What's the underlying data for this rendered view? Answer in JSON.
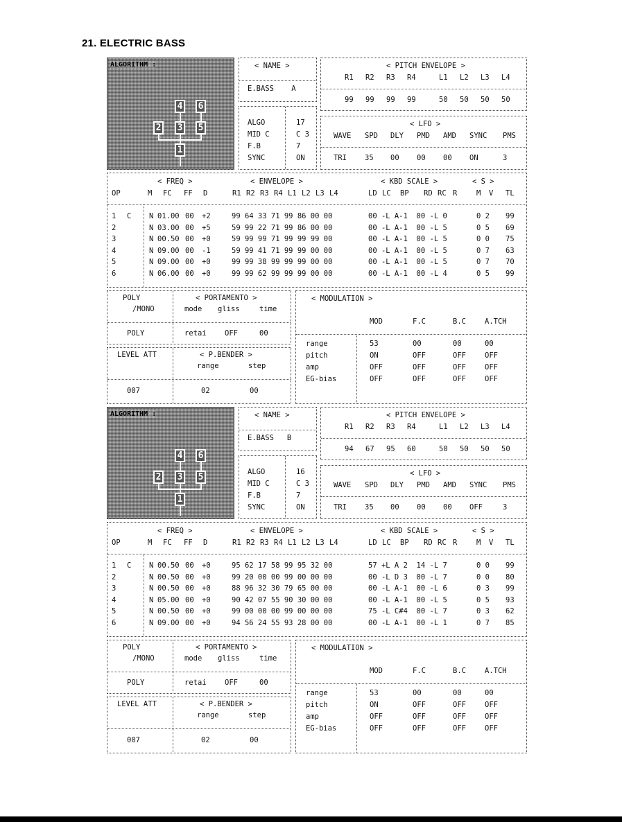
{
  "page_title": "21. ELECTRIC BASS",
  "patches": [
    {
      "algorithm_label": "ALGORITHM :",
      "name_header": "< NAME >",
      "name_value": "E.BASS    A",
      "algo_labels": [
        "ALGO",
        "MID C",
        "F.B",
        "SYNC"
      ],
      "algo_values": [
        "17",
        "C 3",
        "7",
        "ON"
      ],
      "pitch_env": {
        "header": "< PITCH ENVELOPE >",
        "labels": [
          "R1",
          "R2",
          "R3",
          "R4",
          "L1",
          "L2",
          "L3",
          "L4"
        ],
        "values": [
          "99",
          "99",
          "99",
          "99",
          "50",
          "50",
          "50",
          "50"
        ]
      },
      "lfo": {
        "header": "< LFO >",
        "labels": [
          "WAVE",
          "SPD",
          "DLY",
          "PMD",
          "AMD",
          "SYNC",
          "PMS"
        ],
        "values": [
          "TRI",
          "35",
          "00",
          "00",
          "00",
          "ON",
          "3"
        ]
      },
      "ops": {
        "group_headers": [
          "< FREQ >",
          "< ENVELOPE >",
          "< KBD SCALE >",
          "< S >"
        ],
        "columns": [
          "OP",
          "M",
          "FC",
          "FF",
          "D",
          "R1",
          "R2",
          "R3",
          "R4",
          "L1",
          "L2",
          "L3",
          "L4",
          "LD",
          "LC",
          "BP",
          "RD",
          "RC",
          "R",
          "M",
          "V",
          "TL"
        ],
        "rows": [
          {
            "op": "1",
            "c": "C",
            "m": "N",
            "fc": "01.00",
            "ff": "00",
            "d": "+2",
            "env": "99 64 33 71 99 86 00 00",
            "kbd": "00 -L A-1  00 -L 0",
            "s": "0 2",
            "tl": "99"
          },
          {
            "op": "2",
            "c": "",
            "m": "N",
            "fc": "03.00",
            "ff": "00",
            "d": "+5",
            "env": "59 99 22 71 99 86 00 00",
            "kbd": "00 -L A-1  00 -L 5",
            "s": "0 5",
            "tl": "69"
          },
          {
            "op": "3",
            "c": "",
            "m": "N",
            "fc": "00.50",
            "ff": "00",
            "d": "+0",
            "env": "59 99 99 71 99 99 99 00",
            "kbd": "00 -L A-1  00 -L 5",
            "s": "0 0",
            "tl": "75"
          },
          {
            "op": "4",
            "c": "",
            "m": "N",
            "fc": "09.00",
            "ff": "00",
            "d": "-1",
            "env": "59 99 41 71 99 99 00 00",
            "kbd": "00 -L A-1  00 -L 5",
            "s": "0 7",
            "tl": "63"
          },
          {
            "op": "5",
            "c": "",
            "m": "N",
            "fc": "09.00",
            "ff": "00",
            "d": "+0",
            "env": "99 99 38 99 99 99 00 00",
            "kbd": "00 -L A-1  00 -L 5",
            "s": "0 7",
            "tl": "70"
          },
          {
            "op": "6",
            "c": "",
            "m": "N",
            "fc": "06.00",
            "ff": "00",
            "d": "+0",
            "env": "99 99 62 99 99 99 00 00",
            "kbd": "00 -L A-1  00 -L 4",
            "s": "0 5",
            "tl": "99"
          }
        ]
      },
      "poly_mono": {
        "label1": "POLY",
        "label2": "/MONO",
        "value": "POLY"
      },
      "portamento": {
        "header": "< PORTAMENTO >",
        "labels": [
          "mode",
          "gliss",
          "time"
        ],
        "values": [
          "retai",
          "OFF",
          "00"
        ]
      },
      "level_att": {
        "label": "LEVEL ATT",
        "value": "007"
      },
      "p_bender": {
        "header": "< P.BENDER >",
        "labels": [
          "range",
          "step"
        ],
        "values": [
          "02",
          "00"
        ]
      },
      "modulation": {
        "header": "< MODULATION >",
        "columns": [
          "MOD",
          "F.C",
          "B.C",
          "A.TCH"
        ],
        "rows": [
          {
            "label": "range",
            "values": [
              "53",
              "00",
              "00",
              "00"
            ]
          },
          {
            "label": "pitch",
            "values": [
              "ON",
              "OFF",
              "OFF",
              "OFF"
            ]
          },
          {
            "label": "amp",
            "values": [
              "OFF",
              "OFF",
              "OFF",
              "OFF"
            ]
          },
          {
            "label": "EG-bias",
            "values": [
              "OFF",
              "OFF",
              "OFF",
              "OFF"
            ]
          }
        ]
      }
    },
    {
      "algorithm_label": "ALGORITHM :",
      "name_header": "< NAME >",
      "name_value": "E.BASS   B",
      "algo_labels": [
        "ALGO",
        "MID C",
        "F.B",
        "SYNC"
      ],
      "algo_values": [
        "16",
        "C 3",
        "7",
        "ON"
      ],
      "pitch_env": {
        "header": "< PITCH ENVELOPE >",
        "labels": [
          "R1",
          "R2",
          "R3",
          "R4",
          "L1",
          "L2",
          "L3",
          "L4"
        ],
        "values": [
          "94",
          "67",
          "95",
          "60",
          "50",
          "50",
          "50",
          "50"
        ]
      },
      "lfo": {
        "header": "< LFO >",
        "labels": [
          "WAVE",
          "SPD",
          "DLY",
          "PMD",
          "AMD",
          "SYNC",
          "PMS"
        ],
        "values": [
          "TRI",
          "35",
          "00",
          "00",
          "00",
          "OFF",
          "3"
        ]
      },
      "ops": {
        "group_headers": [
          "< FREQ >",
          "< ENVELOPE >",
          "< KBD SCALE >",
          "< S >"
        ],
        "columns": [
          "OP",
          "M",
          "FC",
          "FF",
          "D",
          "R1",
          "R2",
          "R3",
          "R4",
          "L1",
          "L2",
          "L3",
          "L4",
          "LD",
          "LC",
          "BP",
          "RD",
          "RC",
          "R",
          "M",
          "V",
          "TL"
        ],
        "rows": [
          {
            "op": "1",
            "c": "C",
            "m": "N",
            "fc": "00.50",
            "ff": "00",
            "d": "+0",
            "env": "95 62 17 58 99 95 32 00",
            "kbd": "57 +L A 2  14 -L 7",
            "s": "0 0",
            "tl": "99"
          },
          {
            "op": "2",
            "c": "",
            "m": "N",
            "fc": "00.50",
            "ff": "00",
            "d": "+0",
            "env": "99 20 00 00 99 00 00 00",
            "kbd": "00 -L D 3  00 -L 7",
            "s": "0 0",
            "tl": "80"
          },
          {
            "op": "3",
            "c": "",
            "m": "N",
            "fc": "00.50",
            "ff": "00",
            "d": "+0",
            "env": "88 96 32 30 79 65 00 00",
            "kbd": "00 -L A-1  00 -L 6",
            "s": "0 3",
            "tl": "99"
          },
          {
            "op": "4",
            "c": "",
            "m": "N",
            "fc": "05.00",
            "ff": "00",
            "d": "+0",
            "env": "90 42 07 55 90 30 00 00",
            "kbd": "00 -L A-1  00 -L 5",
            "s": "0 5",
            "tl": "93"
          },
          {
            "op": "5",
            "c": "",
            "m": "N",
            "fc": "00.50",
            "ff": "00",
            "d": "+0",
            "env": "99 00 00 00 99 00 00 00",
            "kbd": "75 -L C#4  00 -L 7",
            "s": "0 3",
            "tl": "62"
          },
          {
            "op": "6",
            "c": "",
            "m": "N",
            "fc": "09.00",
            "ff": "00",
            "d": "+0",
            "env": "94 56 24 55 93 28 00 00",
            "kbd": "00 -L A-1  00 -L 1",
            "s": "0 7",
            "tl": "85"
          }
        ]
      },
      "poly_mono": {
        "label1": "POLY",
        "label2": "/MONO",
        "value": "POLY"
      },
      "portamento": {
        "header": "< PORTAMENTO >",
        "labels": [
          "mode",
          "gliss",
          "time"
        ],
        "values": [
          "retai",
          "OFF",
          "00"
        ]
      },
      "level_att": {
        "label": "LEVEL ATT",
        "value": "007"
      },
      "p_bender": {
        "header": "< P.BENDER >",
        "labels": [
          "range",
          "step"
        ],
        "values": [
          "02",
          "00"
        ]
      },
      "modulation": {
        "header": "< MODULATION >",
        "columns": [
          "MOD",
          "F.C",
          "B.C",
          "A.TCH"
        ],
        "rows": [
          {
            "label": "range",
            "values": [
              "53",
              "00",
              "00",
              "00"
            ]
          },
          {
            "label": "pitch",
            "values": [
              "ON",
              "OFF",
              "OFF",
              "OFF"
            ]
          },
          {
            "label": "amp",
            "values": [
              "OFF",
              "OFF",
              "OFF",
              "OFF"
            ]
          },
          {
            "label": "EG-bias",
            "values": [
              "OFF",
              "OFF",
              "OFF",
              "OFF"
            ]
          }
        ]
      }
    }
  ]
}
